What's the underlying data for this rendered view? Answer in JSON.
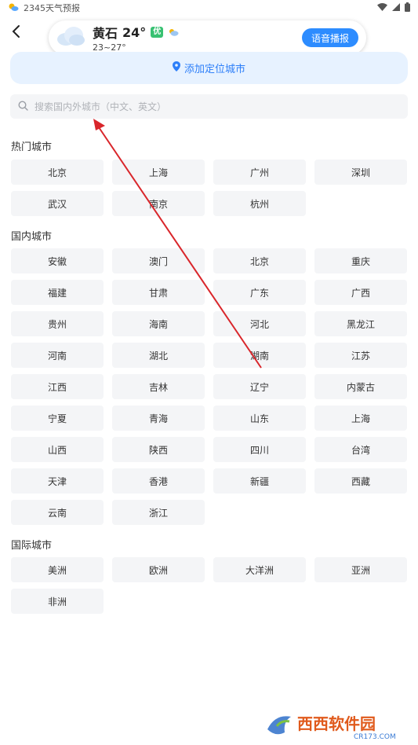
{
  "status_bar": {
    "app_label": "2345天气预报"
  },
  "weather": {
    "city": "黄石",
    "temp": "24°",
    "aqi_badge": "优",
    "range": "23~27°",
    "voice_button": "语音播报"
  },
  "add_location": {
    "label": "添加定位城市"
  },
  "search": {
    "placeholder": "搜索国内外城市（中文、英文）"
  },
  "sections": {
    "hot": {
      "title": "热门城市",
      "cities": [
        "北京",
        "上海",
        "广州",
        "深圳",
        "武汉",
        "南京",
        "杭州"
      ]
    },
    "domestic": {
      "title": "国内城市",
      "cities": [
        "安徽",
        "澳门",
        "北京",
        "重庆",
        "福建",
        "甘肃",
        "广东",
        "广西",
        "贵州",
        "海南",
        "河北",
        "黑龙江",
        "河南",
        "湖北",
        "湖南",
        "江苏",
        "江西",
        "吉林",
        "辽宁",
        "内蒙古",
        "宁夏",
        "青海",
        "山东",
        "上海",
        "山西",
        "陕西",
        "四川",
        "台湾",
        "天津",
        "香港",
        "新疆",
        "西藏",
        "云南",
        "浙江"
      ]
    },
    "international": {
      "title": "国际城市",
      "cities": [
        "美洲",
        "欧洲",
        "大洋洲",
        "亚洲",
        "非洲"
      ]
    }
  },
  "watermark": {
    "text": "西西软件园",
    "sub": "CR173.COM"
  },
  "colors": {
    "accent": "#2d8cff",
    "aqi_good": "#38c172",
    "annotation_arrow": "#d9262b",
    "button_bg": "#f4f5f7"
  }
}
